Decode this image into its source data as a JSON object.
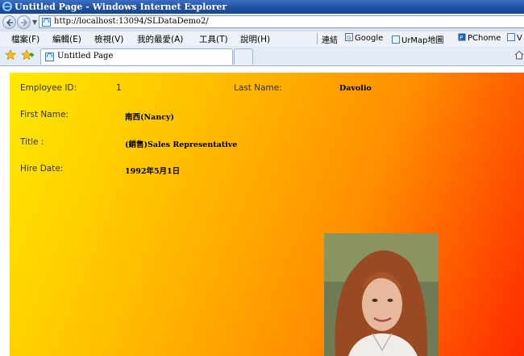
{
  "window": {
    "title": "Untitled Page - Windows Internet Explorer"
  },
  "address": {
    "url": "http://localhost:13094/SLDataDemo2/"
  },
  "menu": {
    "items": [
      "檔案(F)",
      "編輯(E)",
      "檢視(V)",
      "我的最愛(A)",
      "工具(T)",
      "說明(H)"
    ],
    "links_label": "連結",
    "links": [
      "Google",
      "UrMap地圖",
      "PChome",
      "V"
    ]
  },
  "tab": {
    "title": "Untitled Page"
  },
  "employee": {
    "id_label": "Employee ID:",
    "id_value": "1",
    "last_name_label": "Last Name:",
    "last_name_value": "Davolio",
    "first_name_label": "First Name:",
    "first_name_value": "南西(Nancy)",
    "title_label": "Title :",
    "title_value": "(銷售)Sales Representative",
    "hire_date_label": "Hire Date:",
    "hire_date_value": "1992年5月1日"
  },
  "colors": {
    "gradient_start": "#ffea00",
    "gradient_end": "#ff2a00",
    "title_bar": "#1f4f9d"
  },
  "icons": [
    "ie-logo-icon",
    "back-arrow-icon",
    "forward-arrow-icon",
    "page-icon",
    "favorites-star-icon",
    "add-favorites-icon",
    "home-icon"
  ]
}
